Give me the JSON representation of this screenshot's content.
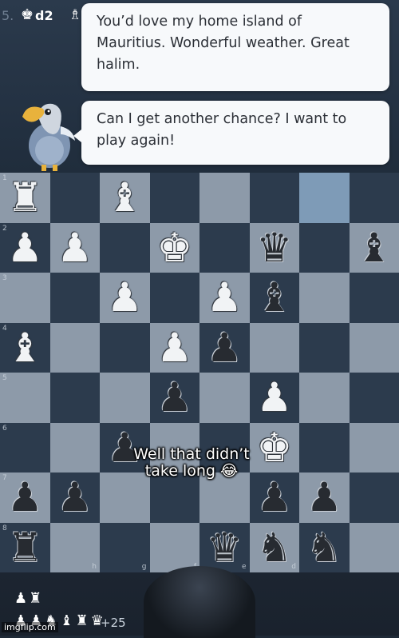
{
  "header": {
    "move_number": "5.",
    "move_king_icon": "white-king-icon",
    "move_square": "d2",
    "move_next_icon": "bishop-icon"
  },
  "chat": {
    "message1": "You’d love my home island of Mauritius. Wonderful weather. Great halim.",
    "message2": "Can I get another chance? I want to play again!"
  },
  "opponent": {
    "avatar": "dodo-avatar"
  },
  "board": {
    "rank_labels": [
      "1",
      "2",
      "3",
      "4",
      "5",
      "6",
      "7",
      "8"
    ],
    "file_labels": [
      "h",
      "g",
      "f",
      "e",
      "d"
    ],
    "highlight_square": "r0c6",
    "rows": [
      [
        "wR",
        "",
        "wB",
        "",
        "",
        "",
        "",
        ""
      ],
      [
        "wP",
        "wP",
        "",
        "wK",
        "",
        "bQ",
        "",
        "bB"
      ],
      [
        "",
        "",
        "wP",
        "",
        "wP",
        "bB",
        "",
        ""
      ],
      [
        "wB",
        "",
        "",
        "wP",
        "bP",
        "",
        "",
        ""
      ],
      [
        "",
        "",
        "",
        "bP",
        "",
        "wP",
        "",
        ""
      ],
      [
        "",
        "",
        "bP",
        "",
        "",
        "wK",
        "",
        ""
      ],
      [
        "bP",
        "bP",
        "",
        "",
        "",
        "bP",
        "bP",
        ""
      ],
      [
        "bR",
        "",
        "",
        "",
        "bQ",
        "bN",
        "bN",
        ""
      ]
    ]
  },
  "caption": "Well that didn’t take long 😂",
  "captured": {
    "row1": "♟♜",
    "row2": "♟♟♞♝♜♛",
    "material": "+25"
  },
  "watermark": "imgflip.com",
  "colors": {
    "light_square": "#8d9aa9",
    "dark_square": "#2c3b4d",
    "highlight": "#7e9bb7"
  }
}
